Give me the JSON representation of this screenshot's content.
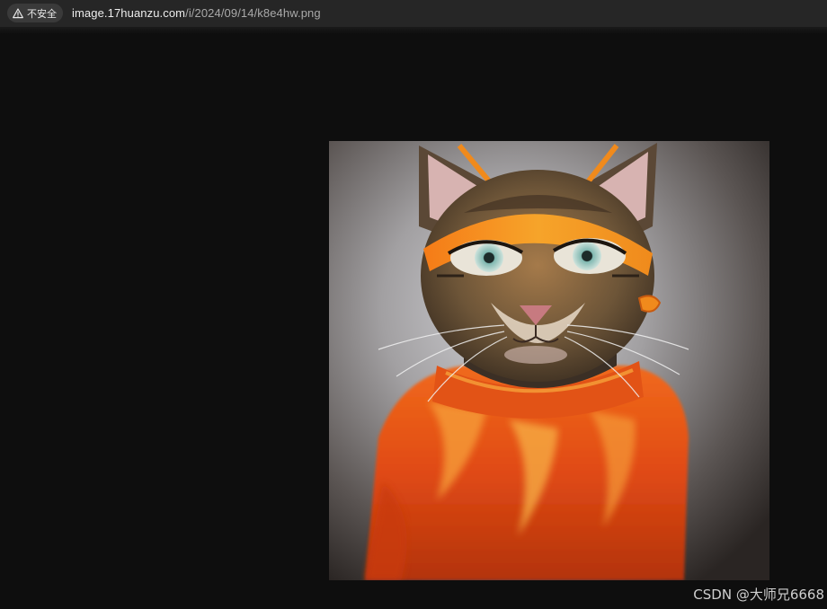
{
  "browser": {
    "security_label": "不安全",
    "url_host": "image.17huanzu.com",
    "url_path": "/i/2024/09/14/k8e4hw.png"
  },
  "viewer": {
    "image_subject": "cat-in-orange-outfit-illustration"
  },
  "watermark": "CSDN @大师兄6668",
  "colors": {
    "toolbar_bg": "#262626",
    "page_bg": "#0e0e0e",
    "outfit_orange": "#e8501a",
    "headband_orange": "#f08a1c",
    "eye_teal": "#8fc2bd"
  }
}
